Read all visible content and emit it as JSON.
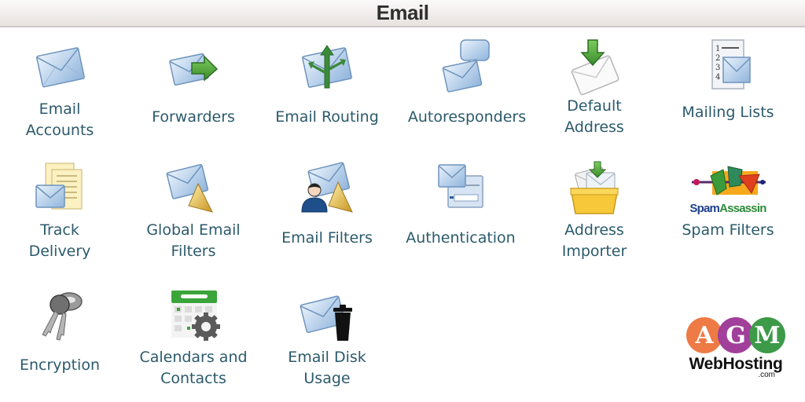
{
  "header": {
    "title": "Email"
  },
  "items": [
    {
      "label": "Email Accounts",
      "lines": [
        "Email",
        "Accounts"
      ],
      "icon": "envelope-icon"
    },
    {
      "label": "Forwarders",
      "lines": [
        "Forwarders"
      ],
      "icon": "envelope-forward-icon"
    },
    {
      "label": "Email Routing",
      "lines": [
        "Email Routing"
      ],
      "icon": "envelope-routing-icon"
    },
    {
      "label": "Autoresponders",
      "lines": [
        "Autoresponders"
      ],
      "icon": "envelope-speech-bubble-icon"
    },
    {
      "label": "Default Address",
      "lines": [
        "Default",
        "Address"
      ],
      "icon": "envelope-download-arrow-icon"
    },
    {
      "label": "Mailing Lists",
      "lines": [
        "Mailing Lists"
      ],
      "icon": "numbered-list-envelope-icon"
    },
    {
      "label": "Track Delivery",
      "lines": [
        "Track",
        "Delivery"
      ],
      "icon": "documents-envelope-icon"
    },
    {
      "label": "Global Email Filters",
      "lines": [
        "Global Email",
        "Filters"
      ],
      "icon": "envelope-funnel-icon"
    },
    {
      "label": "Email Filters",
      "lines": [
        "Email Filters"
      ],
      "icon": "user-envelope-funnel-icon"
    },
    {
      "label": "Authentication",
      "lines": [
        "Authentication"
      ],
      "icon": "envelope-form-icon"
    },
    {
      "label": "Address Importer",
      "lines": [
        "Address",
        "Importer"
      ],
      "icon": "inbox-tray-import-icon"
    },
    {
      "label": "Spam Filters",
      "lines": [
        "Spam Filters"
      ],
      "icon": "spamassassin-icon",
      "icon_text": "SpamAssassin"
    },
    {
      "label": "Encryption",
      "lines": [
        "Encryption"
      ],
      "icon": "keys-icon"
    },
    {
      "label": "Calendars and Contacts",
      "lines": [
        "Calendars and",
        "Contacts"
      ],
      "icon": "calendar-gear-icon"
    },
    {
      "label": "Email Disk Usage",
      "lines": [
        "Email Disk",
        "Usage"
      ],
      "icon": "envelope-trash-icon"
    }
  ],
  "logo": {
    "letters": [
      "A",
      "G",
      "M"
    ],
    "colors": [
      "#ee7a45",
      "#a13f9b",
      "#3d9a48"
    ],
    "name": "WebHosting",
    "suffix": ".com"
  }
}
